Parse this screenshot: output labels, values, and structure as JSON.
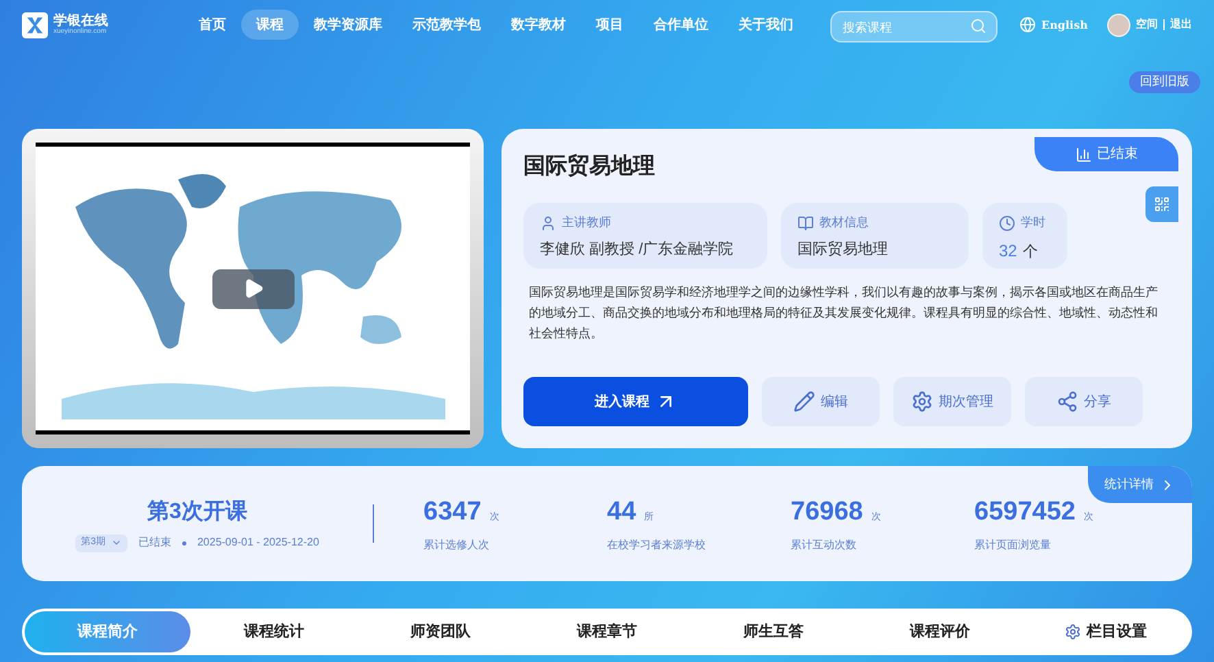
{
  "logo": {
    "name": "学银在线",
    "domain": "xueyinonline.com"
  },
  "nav": [
    {
      "label": "首页",
      "selected": false
    },
    {
      "label": "课程",
      "selected": true
    },
    {
      "label": "教学资源库",
      "selected": false
    },
    {
      "label": "示范教学包",
      "selected": false
    },
    {
      "label": "数字教材",
      "selected": false
    },
    {
      "label": "项目",
      "selected": false
    },
    {
      "label": "合作单位",
      "selected": false
    },
    {
      "label": "关于我们",
      "selected": false
    }
  ],
  "search": {
    "placeholder": "搜索课程"
  },
  "language": "English",
  "user": {
    "name": "空间",
    "logout": "退出"
  },
  "old_version_button": "回到旧版",
  "course": {
    "title": "国际贸易地理",
    "status": "已结束",
    "info": [
      {
        "kind": "teacher",
        "label": "主讲教师",
        "value": "李健欣 副教授 /广东金融学院"
      },
      {
        "kind": "textbook",
        "label": "教材信息",
        "value": "国际贸易地理"
      },
      {
        "kind": "hours",
        "label": "学时",
        "value": "32",
        "unit": "个"
      }
    ],
    "description": "国际贸易地理是国际贸易学和经济地理学之间的边缘性学科，我们以有趣的故事与案例，揭示各国或地区在商品生产的地域分工、商品交换的地域分布和地理格局的特征及其发展变化规律。课程具有明显的综合性、地域性、动态性和社会性特点。",
    "actions": [
      {
        "kind": "enter",
        "label": "进入课程"
      },
      {
        "kind": "edit",
        "label": "编辑"
      },
      {
        "kind": "manage",
        "label": "期次管理"
      },
      {
        "kind": "share",
        "label": "分享"
      }
    ]
  },
  "session": {
    "title": "第3次开课",
    "term": "第3期",
    "status": "已结束",
    "dates": "2025-09-01 - 2025-12-20"
  },
  "stats": [
    {
      "value": "6347",
      "unit": "次",
      "label": "累计选修人次"
    },
    {
      "value": "44",
      "unit": "所",
      "label": "在校学习者来源学校"
    },
    {
      "value": "76968",
      "unit": "次",
      "label": "累计互动次数"
    },
    {
      "value": "6597452",
      "unit": "次",
      "label": "累计页面浏览量"
    }
  ],
  "stats_detail_button": "统计详情",
  "tabs": [
    {
      "label": "课程简介",
      "selected": true,
      "kind": "tab"
    },
    {
      "label": "课程统计",
      "selected": false,
      "kind": "tab"
    },
    {
      "label": "师资团队",
      "selected": false,
      "kind": "tab"
    },
    {
      "label": "课程章节",
      "selected": false,
      "kind": "tab"
    },
    {
      "label": "师生互答",
      "selected": false,
      "kind": "tab"
    },
    {
      "label": "课程评价",
      "selected": false,
      "kind": "tab"
    },
    {
      "label": "栏目设置",
      "selected": false,
      "kind": "settings"
    }
  ]
}
